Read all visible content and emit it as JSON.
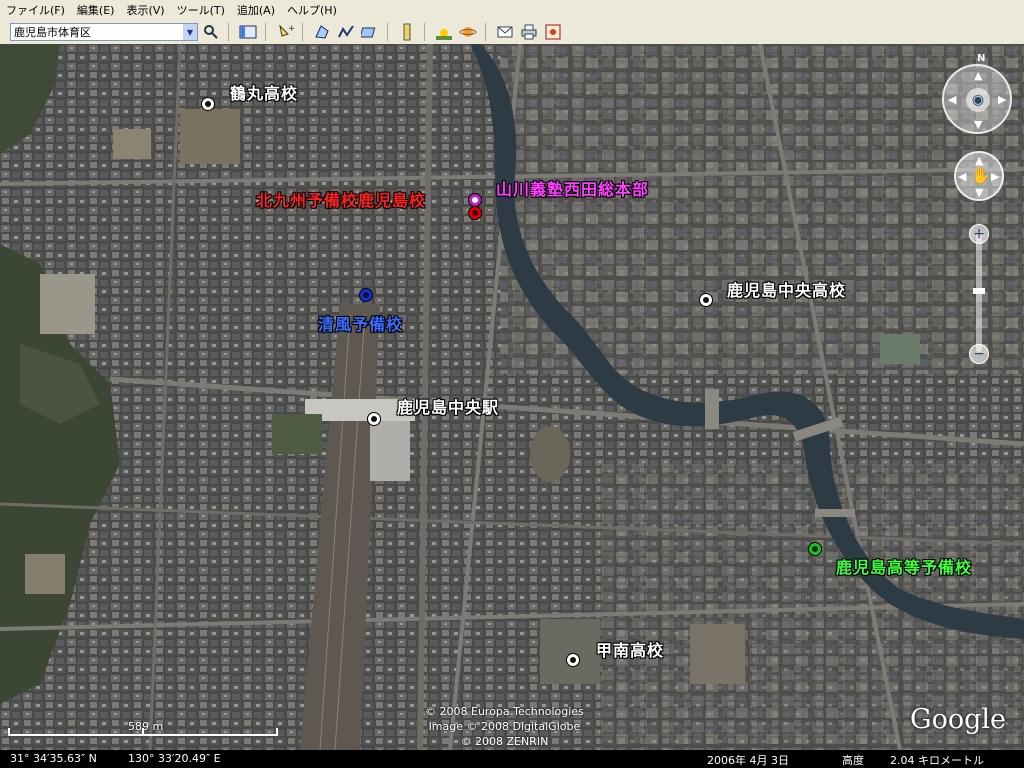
{
  "menu": [
    "ファイル(F)",
    "編集(E)",
    "表示(V)",
    "ツール(T)",
    "追加(A)",
    "ヘルプ(H)"
  ],
  "toolbar": {
    "search_value": "鹿児島市体育区",
    "icons": [
      "search-icon",
      "sidebar-icon",
      "placemark-icon",
      "polygon-icon",
      "path-icon",
      "overlay-icon",
      "ruler-icon",
      "sun-icon",
      "planet-icon",
      "email-icon",
      "print-icon",
      "maps-icon"
    ]
  },
  "map": {
    "places": [
      {
        "name": "鶴丸高校",
        "pin": "white"
      },
      {
        "name": "北九州予備校鹿児島校",
        "pin": "red"
      },
      {
        "name": "山川義塾西田総本部",
        "pin": "magenta"
      },
      {
        "name": "清風予備校",
        "pin": "blue"
      },
      {
        "name": "鹿児島中央高校",
        "pin": "white"
      },
      {
        "name": "鹿児島中央駅",
        "pin": "white"
      },
      {
        "name": "鹿児島高等予備校",
        "pin": "green"
      },
      {
        "name": "甲南高校",
        "pin": "white"
      }
    ],
    "copyright": [
      "© 2008 Europa Technologies",
      "Image © 2008 DigitalGlobe",
      "© 2008 ZENRIN"
    ],
    "logo": "Google",
    "scale_label": "589 m",
    "compass_label": "N"
  },
  "status": {
    "lat": "31° 34′35.63″ N",
    "lon": "130° 33′20.49″ E",
    "date": "2006年 4月 3日",
    "altitude_label": "高度",
    "altitude_value": "2.04 キロメートル"
  }
}
